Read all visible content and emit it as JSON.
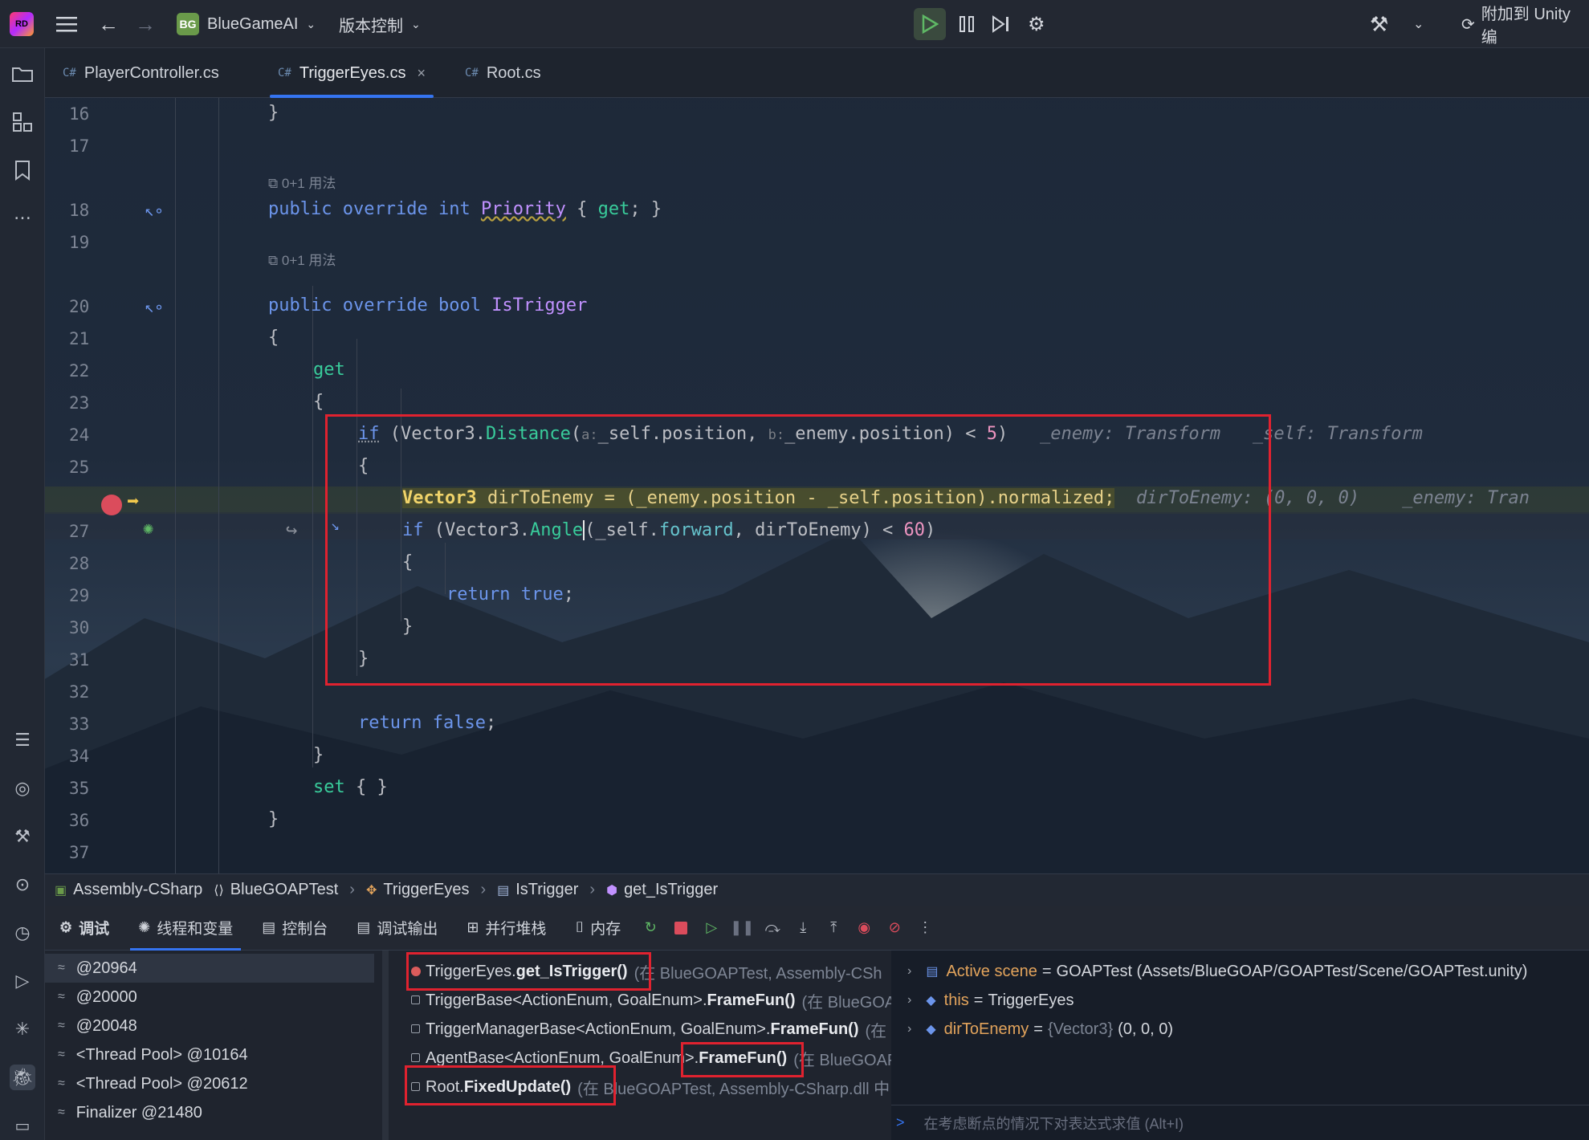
{
  "titlebar": {
    "logo_text": "RD",
    "project_badge": "BG",
    "project_name": "BlueGameAI",
    "vcs_label": "版本控制",
    "attach_label": "附加到 Unity 编"
  },
  "tabs": [
    {
      "label": "PlayerController.cs",
      "prefix": "C#"
    },
    {
      "label": "TriggerEyes.cs",
      "prefix": "C#",
      "active": true
    },
    {
      "label": "Root.cs",
      "prefix": "C#"
    }
  ],
  "editor": {
    "line_numbers": [
      "16",
      "17",
      "18",
      "19",
      "20",
      "21",
      "22",
      "23",
      "24",
      "25",
      "26",
      "27",
      "28",
      "29",
      "30",
      "31",
      "32",
      "33",
      "34",
      "35",
      "36",
      "37"
    ],
    "usage_hint": "0+1 用法",
    "lines": {
      "l16": "}",
      "l18_kw1": "public",
      "l18_kw2": "override",
      "l18_kw3": "int",
      "l18_name": "Priority",
      "l18_rest1": "{",
      "l18_get": "get",
      "l18_rest2": "; }",
      "l20_kw1": "public",
      "l20_kw2": "override",
      "l20_kw3": "bool",
      "l20_name": "IsTrigger",
      "l21": "{",
      "l22": "get",
      "l23": "{",
      "l24_if": "if",
      "l24_a": " (Vector3.",
      "l24_fn": "Distance",
      "l24_b": "(",
      "l24_h1": "a:",
      "l24_c": "_self.position, ",
      "l24_h2": "b:",
      "l24_d": "_enemy.position) < ",
      "l24_num": "5",
      "l24_e": ")",
      "l24_inl1": "_enemy: Transform",
      "l24_inl2": "_self: Transform",
      "l25": "{",
      "l26_ty": "Vector3",
      "l26_a": " dirToEnemy = (_enemy.position - _self.position).normalized;",
      "l26_inl1": "dirToEnemy: (0, 0, 0)",
      "l26_inl2": "_enemy: Tran",
      "l27_if": "if",
      "l27_a": " (Vector3.",
      "l27_fn": "Angle",
      "l27_b": "(_self.",
      "l27_prop": "forward",
      "l27_c": ", dirToEnemy) < ",
      "l27_num": "60",
      "l27_d": ")",
      "l28": "{",
      "l29_kw": "return",
      "l29_kw2": "true",
      "l29_rest": ";",
      "l30": "}",
      "l31": "}",
      "l33_kw": "return",
      "l33_kw2": "false",
      "l33_rest": ";",
      "l34": "}",
      "l35_kw": "set",
      "l35_rest": " { }",
      "l36": "}"
    }
  },
  "breadcrumb": [
    "Assembly-CSharp",
    "BlueGOAPTest",
    "TriggerEyes",
    "IsTrigger",
    "get_IsTrigger"
  ],
  "debug": {
    "tabs": [
      "调试",
      "线程和变量",
      "控制台",
      "调试输出",
      "并行堆栈",
      "内存"
    ],
    "threads": [
      "@20964",
      "@20000",
      "@20048",
      "<Thread Pool> @10164",
      "<Thread Pool> @20612",
      "Finalizer @21480"
    ],
    "frames": [
      {
        "pre": "TriggerEyes.",
        "bold": "get_IsTrigger()",
        "dim": "(在 BlueGOAPTest, Assembly-CSh"
      },
      {
        "pre": "TriggerBase<ActionEnum, GoalEnum>.",
        "bold": "FrameFun()",
        "dim": "(在 BlueGOA"
      },
      {
        "pre": "TriggerManagerBase<ActionEnum, GoalEnum>.",
        "bold": "FrameFun()",
        "dim": "(在"
      },
      {
        "pre": "AgentBase<ActionEnum, GoalEnum>.",
        "bold": "FrameFun()",
        "dim": "(在 BlueGOAP"
      },
      {
        "pre": "Root.",
        "bold": "FixedUpdate()",
        "dim": "(在 BlueGOAPTest, Assembly-CSharp.dll 中"
      }
    ],
    "variables": [
      {
        "name": "Active scene",
        "type": "",
        "value": "GOAPTest (Assets/BlueGOAP/GOAPTest/Scene/GOAPTest.unity)"
      },
      {
        "name": "this",
        "type": "",
        "value": "TriggerEyes"
      },
      {
        "name": "dirToEnemy",
        "type": "{Vector3}",
        "value": "(0, 0, 0)"
      }
    ],
    "eval_placeholder": "在考虑断点的情况下对表达式求值 (Alt+I)"
  }
}
